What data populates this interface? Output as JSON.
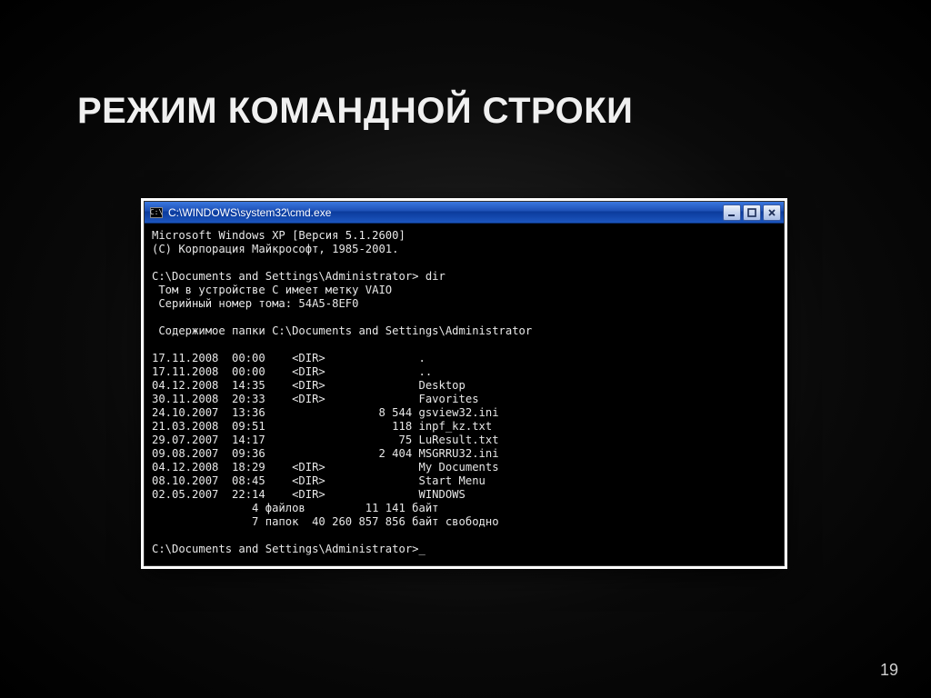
{
  "slide": {
    "title": "РЕЖИМ КОМАНДНОЙ СТРОКИ",
    "page_number": "19"
  },
  "window": {
    "icon_label": "C:\\",
    "title": "C:\\WINDOWS\\system32\\cmd.exe",
    "buttons": {
      "minimize": "minimize",
      "maximize": "maximize",
      "close": "close"
    }
  },
  "terminal": {
    "banner_line1": "Microsoft Windows XP [Версия 5.1.2600]",
    "banner_line2": "(C) Корпорация Майкрософт, 1985-2001.",
    "prompt1": "C:\\Documents and Settings\\Administrator> dir",
    "vol_line": " Том в устройстве C имеет метку VAIO",
    "serial_line": " Серийный номер тома: 54A5-8EF0",
    "dir_header": " Содержимое папки C:\\Documents and Settings\\Administrator",
    "entries": [
      {
        "date": "17.11.2008",
        "time": "00:00",
        "type": "<DIR>",
        "size": "",
        "name": "."
      },
      {
        "date": "17.11.2008",
        "time": "00:00",
        "type": "<DIR>",
        "size": "",
        "name": ".."
      },
      {
        "date": "04.12.2008",
        "time": "14:35",
        "type": "<DIR>",
        "size": "",
        "name": "Desktop"
      },
      {
        "date": "30.11.2008",
        "time": "20:33",
        "type": "<DIR>",
        "size": "",
        "name": "Favorites"
      },
      {
        "date": "24.10.2007",
        "time": "13:36",
        "type": "",
        "size": "8 544",
        "name": "gsview32.ini"
      },
      {
        "date": "21.03.2008",
        "time": "09:51",
        "type": "",
        "size": "118",
        "name": "inpf_kz.txt"
      },
      {
        "date": "29.07.2007",
        "time": "14:17",
        "type": "",
        "size": "75",
        "name": "LuResult.txt"
      },
      {
        "date": "09.08.2007",
        "time": "09:36",
        "type": "",
        "size": "2 404",
        "name": "MSGRRU32.ini"
      },
      {
        "date": "04.12.2008",
        "time": "18:29",
        "type": "<DIR>",
        "size": "",
        "name": "My Documents"
      },
      {
        "date": "08.10.2007",
        "time": "08:45",
        "type": "<DIR>",
        "size": "",
        "name": "Start Menu"
      },
      {
        "date": "02.05.2007",
        "time": "22:14",
        "type": "<DIR>",
        "size": "",
        "name": "WINDOWS"
      }
    ],
    "summary_files": "               4 файлов         11 141 байт",
    "summary_dirs": "               7 папок  40 260 857 856 байт свободно",
    "prompt2": "C:\\Documents and Settings\\Administrator>_"
  }
}
